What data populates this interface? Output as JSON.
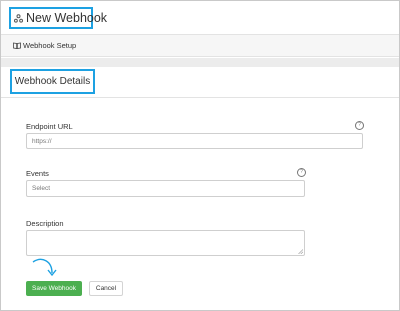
{
  "header": {
    "title": "New Webhook",
    "icon": "webhook-icon"
  },
  "subnav": {
    "label": "Webhook Setup",
    "icon": "book-icon"
  },
  "section": {
    "title": "Webhook Details"
  },
  "fields": {
    "endpoint": {
      "label": "Endpoint URL",
      "placeholder": "https://"
    },
    "events": {
      "label": "Events",
      "value": "Select"
    },
    "description": {
      "label": "Description",
      "value": ""
    }
  },
  "buttons": {
    "save": "Save Webhook",
    "cancel": "Cancel"
  },
  "colors": {
    "highlight": "#1da1e2",
    "primary_button": "#4caf50"
  }
}
